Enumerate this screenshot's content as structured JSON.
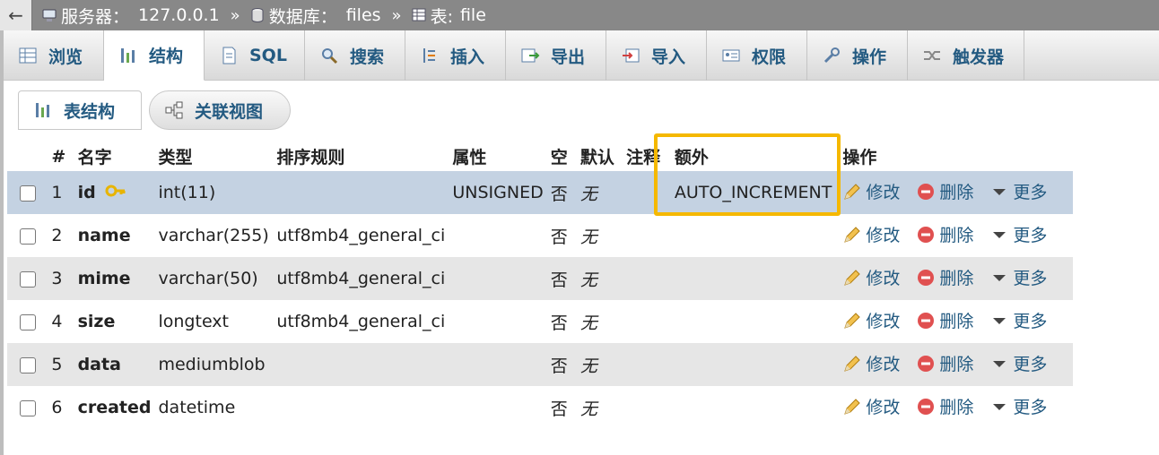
{
  "breadcrumb": {
    "back_symbol": "←",
    "server_label": "服务器：",
    "server_value": "127.0.0.1",
    "database_label": "数据库：",
    "database_value": "files",
    "table_label": "表:",
    "table_value": "file",
    "separator": "»"
  },
  "tabs": [
    {
      "label": "浏览",
      "icon": "browse-icon"
    },
    {
      "label": "结构",
      "icon": "structure-icon",
      "active": true
    },
    {
      "label": "SQL",
      "icon": "sql-icon"
    },
    {
      "label": "搜索",
      "icon": "search-icon"
    },
    {
      "label": "插入",
      "icon": "insert-icon"
    },
    {
      "label": "导出",
      "icon": "export-icon"
    },
    {
      "label": "导入",
      "icon": "import-icon"
    },
    {
      "label": "权限",
      "icon": "privileges-icon"
    },
    {
      "label": "操作",
      "icon": "operations-icon"
    },
    {
      "label": "触发器",
      "icon": "triggers-icon"
    }
  ],
  "subtabs": [
    {
      "label": "表结构",
      "icon": "table-structure-icon"
    },
    {
      "label": "关联视图",
      "icon": "relation-view-icon"
    }
  ],
  "table": {
    "headers": {
      "num": "#",
      "name": "名字",
      "type": "类型",
      "collation": "排序规则",
      "attributes": "属性",
      "null": "空",
      "default": "默认",
      "comments": "注释",
      "extra": "额外",
      "action": "操作"
    },
    "rows": [
      {
        "num": "1",
        "name": "id",
        "type": "int(11)",
        "collation": "",
        "attributes": "UNSIGNED",
        "null": "否",
        "default": "无",
        "comments": "",
        "extra": "AUTO_INCREMENT",
        "primary": true
      },
      {
        "num": "2",
        "name": "name",
        "type": "varchar(255)",
        "collation": "utf8mb4_general_ci",
        "attributes": "",
        "null": "否",
        "default": "无",
        "comments": "",
        "extra": ""
      },
      {
        "num": "3",
        "name": "mime",
        "type": "varchar(50)",
        "collation": "utf8mb4_general_ci",
        "attributes": "",
        "null": "否",
        "default": "无",
        "comments": "",
        "extra": ""
      },
      {
        "num": "4",
        "name": "size",
        "type": "longtext",
        "collation": "utf8mb4_general_ci",
        "attributes": "",
        "null": "否",
        "default": "无",
        "comments": "",
        "extra": ""
      },
      {
        "num": "5",
        "name": "data",
        "type": "mediumblob",
        "collation": "",
        "attributes": "",
        "null": "否",
        "default": "无",
        "comments": "",
        "extra": ""
      },
      {
        "num": "6",
        "name": "created",
        "type": "datetime",
        "collation": "",
        "attributes": "",
        "null": "否",
        "default": "无",
        "comments": "",
        "extra": ""
      }
    ],
    "actions": {
      "edit": "修改",
      "drop": "删除",
      "more": "更多"
    }
  },
  "colors": {
    "accent": "#235a81",
    "highlight": "#f5b800",
    "selected_row": "#c4d2e2",
    "breadcrumb_bg": "#888888"
  }
}
